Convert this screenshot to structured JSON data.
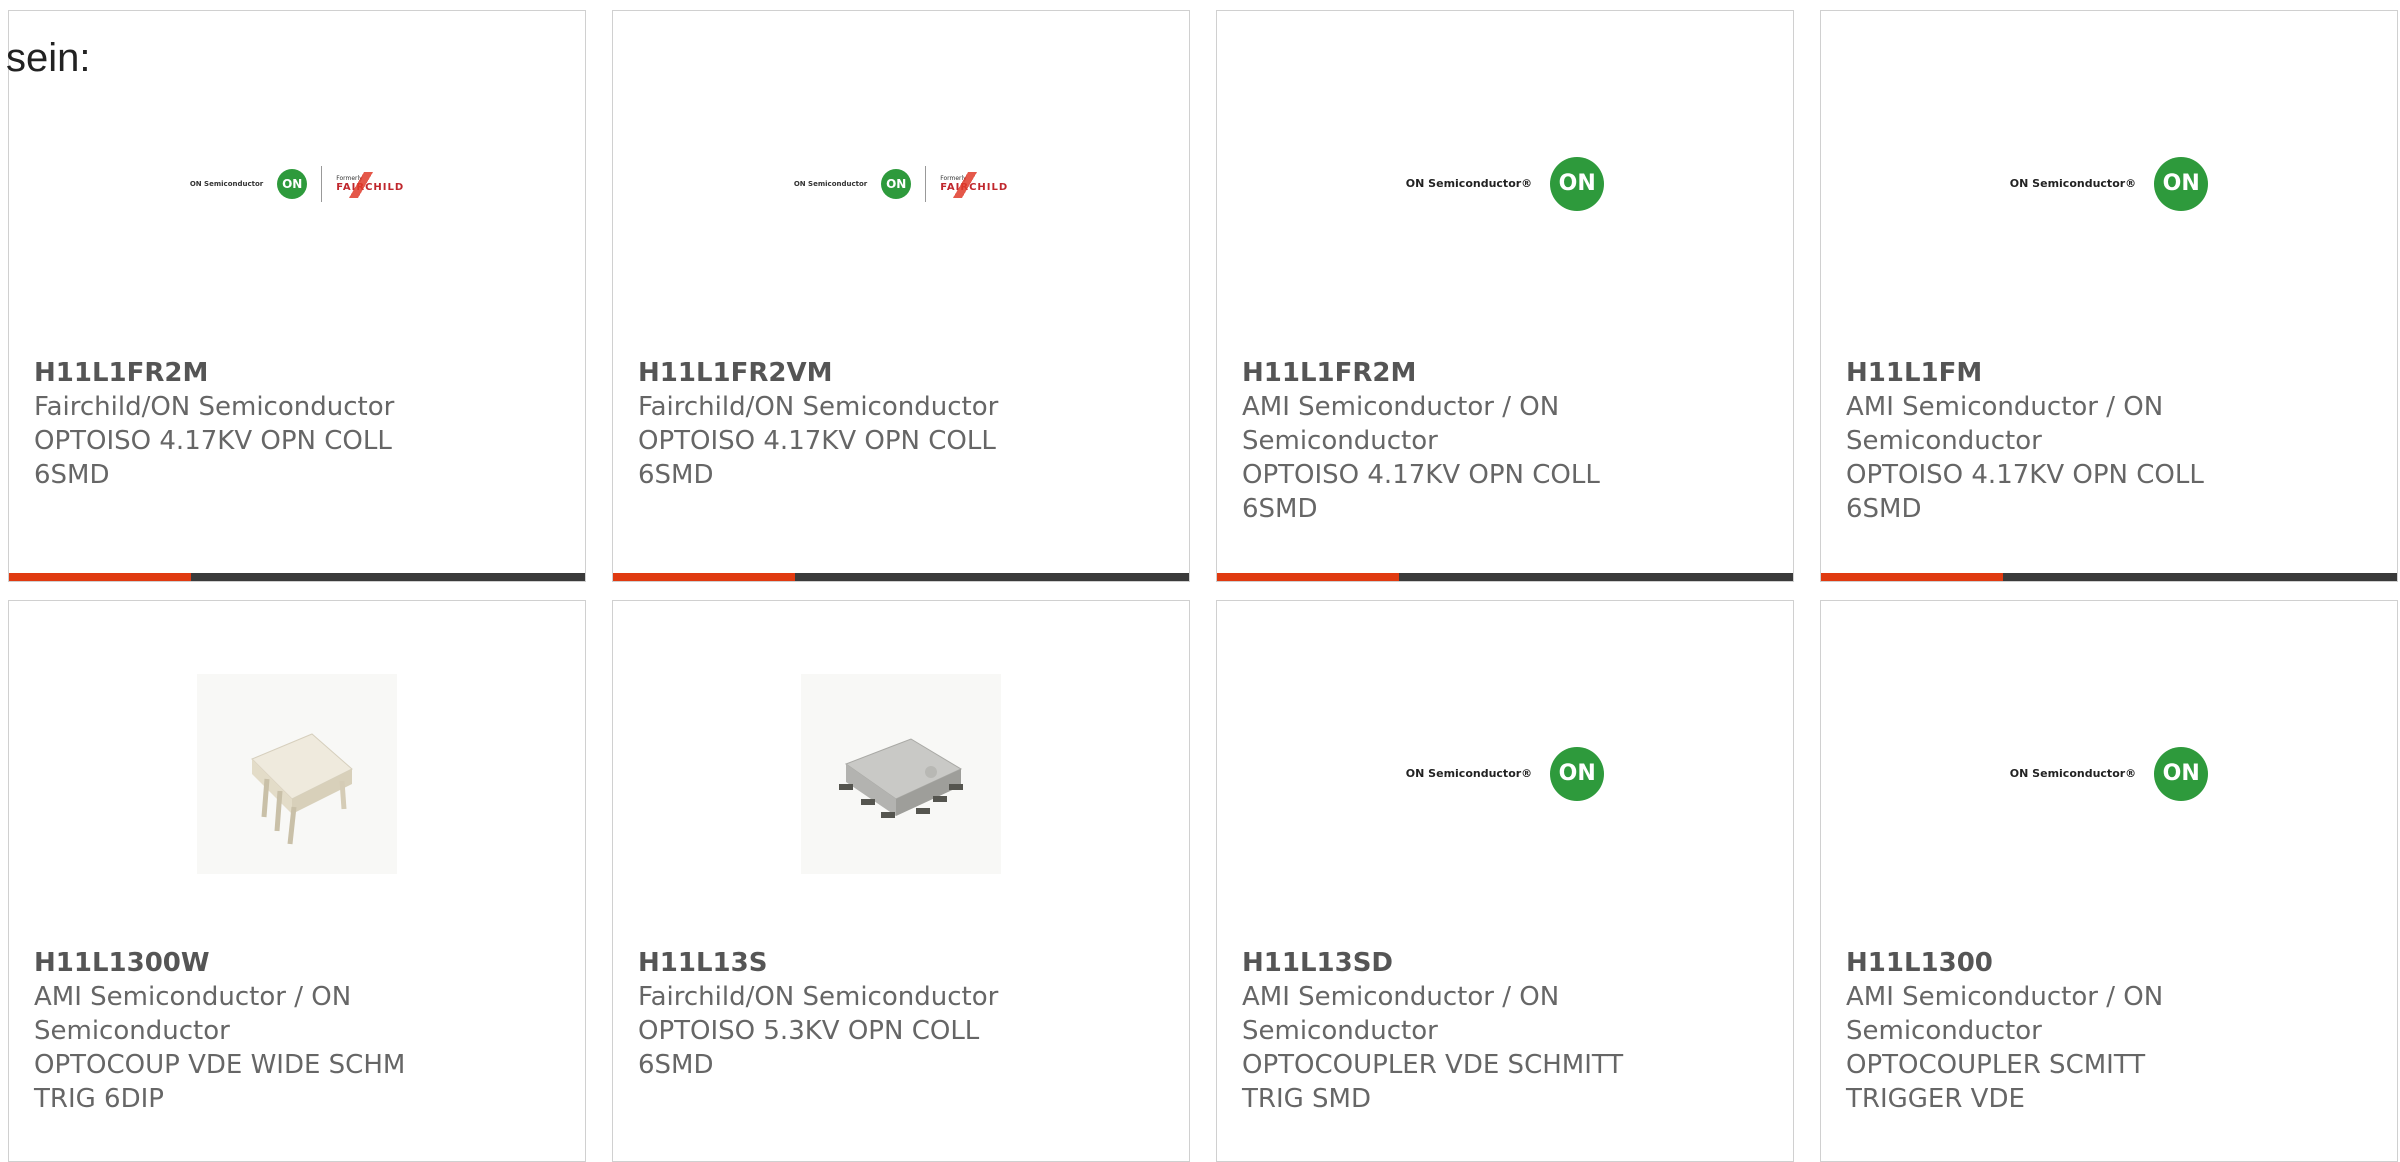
{
  "intro_text": "sein:",
  "logos": {
    "on_semi_label": "ON Semiconductor®",
    "on_semi_small": "ON Semiconductor",
    "on_badge": "ON",
    "formerly": "Formerly",
    "fairchild": "FAIRCHILD"
  },
  "colors": {
    "accent": "#e03a10",
    "bar_dark": "#3a3a3a",
    "on_green": "#2e9a3c"
  },
  "products": [
    {
      "part": "H11L1FR2M",
      "maker": "Fairchild/ON Semiconductor",
      "desc": "OPTOISO 4.17KV OPN COLL 6SMD",
      "image": "on-fairchild-logo"
    },
    {
      "part": "H11L1FR2VM",
      "maker": "Fairchild/ON Semiconductor",
      "desc": "OPTOISO 4.17KV OPN COLL 6SMD",
      "image": "on-fairchild-logo"
    },
    {
      "part": "H11L1FR2M",
      "maker": "AMI Semiconductor / ON Semiconductor",
      "desc": "OPTOISO 4.17KV OPN COLL 6SMD",
      "image": "on-semi-logo"
    },
    {
      "part": "H11L1FM",
      "maker": "AMI Semiconductor / ON Semiconductor",
      "desc": "OPTOISO 4.17KV OPN COLL 6SMD",
      "image": "on-semi-logo"
    },
    {
      "part": "H11L1300W",
      "maker": "AMI Semiconductor / ON Semiconductor",
      "desc": "OPTOCOUP VDE WIDE SCHM TRIG 6DIP",
      "image": "dip-package-photo"
    },
    {
      "part": "H11L13S",
      "maker": "Fairchild/ON Semiconductor",
      "desc": "OPTOISO 5.3KV OPN COLL 6SMD",
      "image": "smd-package-photo"
    },
    {
      "part": "H11L13SD",
      "maker": "AMI Semiconductor / ON Semiconductor",
      "desc": "OPTOCOUPLER VDE SCHMITT TRIG SMD",
      "image": "on-semi-logo"
    },
    {
      "part": "H11L1300",
      "maker": "AMI Semiconductor / ON Semiconductor",
      "desc": "OPTOCOUPLER SCMITT TRIGGER VDE",
      "image": "on-semi-logo"
    }
  ]
}
